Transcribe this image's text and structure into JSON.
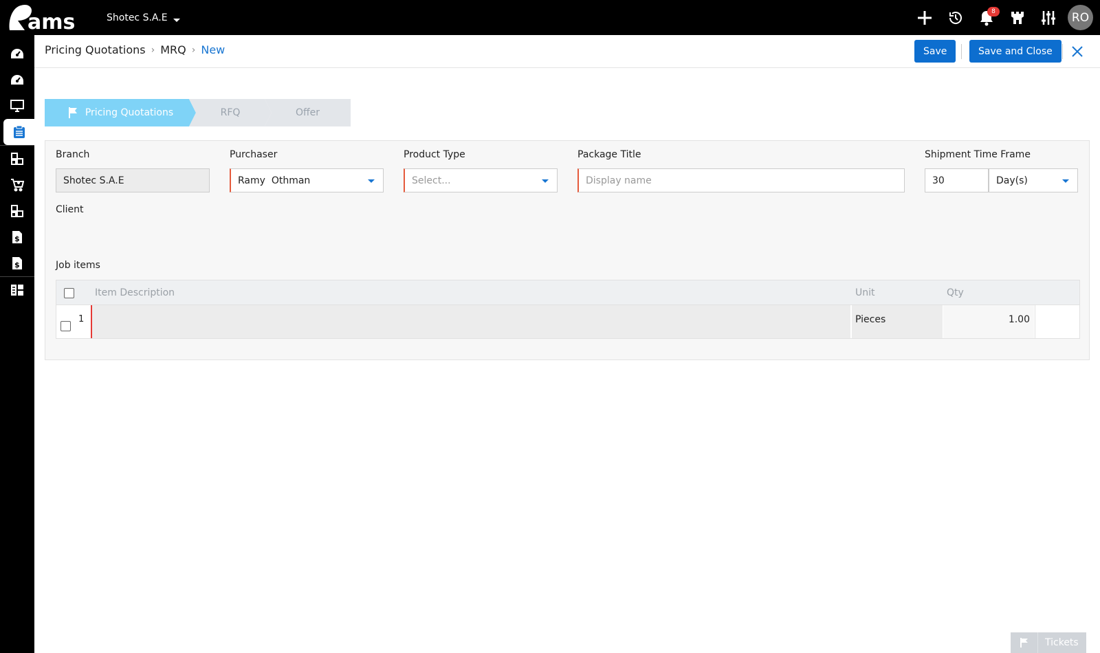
{
  "topbar": {
    "brand": "rams",
    "company": "Shotec S.A.E",
    "notification_count": "8",
    "avatar_initials": "RO"
  },
  "sidebar": {
    "items": [
      {
        "name": "dashboard-1",
        "icon": "dashboard-gauge-icon"
      },
      {
        "name": "dashboard-2",
        "icon": "dashboard-gauge-icon"
      },
      {
        "name": "monitor",
        "icon": "monitor-icon"
      },
      {
        "name": "clipboard",
        "icon": "clipboard-icon",
        "active": true
      },
      {
        "name": "modules",
        "icon": "modules-icon"
      },
      {
        "name": "cart",
        "icon": "cart-icon"
      },
      {
        "name": "modules-2",
        "icon": "modules-icon"
      },
      {
        "name": "invoice-1",
        "icon": "invoice-dollar-icon"
      },
      {
        "name": "invoice-2",
        "icon": "invoice-dollar-icon"
      },
      {
        "name": "grid",
        "icon": "grid-icon"
      }
    ]
  },
  "header": {
    "breadcrumb": [
      "Pricing Quotations",
      "MRQ",
      "New"
    ],
    "save_label": "Save",
    "save_close_label": "Save and Close"
  },
  "stepper": {
    "steps": [
      "Pricing Quotations",
      "RFQ",
      "Offer"
    ],
    "active_index": 0
  },
  "form": {
    "branch": {
      "label": "Branch",
      "value": "Shotec S.A.E"
    },
    "purchaser": {
      "label": "Purchaser",
      "value": "Ramy  Othman"
    },
    "product_type": {
      "label": "Product Type",
      "placeholder": "Select..."
    },
    "package_title": {
      "label": "Package Title",
      "placeholder": "Display name"
    },
    "shipment": {
      "label": "Shipment Time Frame",
      "value": "30",
      "unit": "Day(s)"
    },
    "client": {
      "label": "Client"
    }
  },
  "job_items": {
    "title": "Job items",
    "columns": [
      "Item Description",
      "Unit",
      "Qty"
    ],
    "rows": [
      {
        "no": "1",
        "description": "",
        "unit": "Pieces",
        "qty": "1.00"
      }
    ]
  },
  "tickets": {
    "label": "Tickets"
  },
  "colors": {
    "primary": "#0d6ecf",
    "stepper_active": "#7fd3f7",
    "required": "#e55a3c",
    "topbar": "#000000"
  }
}
